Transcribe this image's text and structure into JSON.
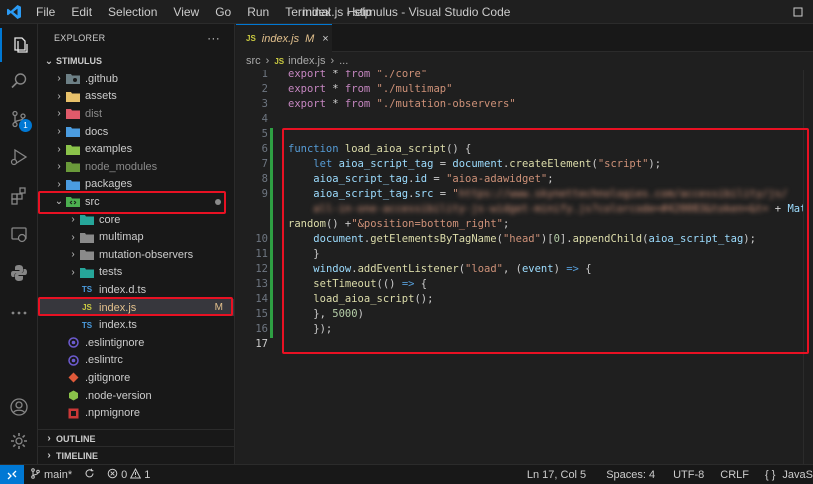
{
  "window": {
    "title": "index.js - stimulus - Visual Studio Code"
  },
  "menu": [
    "File",
    "Edit",
    "Selection",
    "View",
    "Go",
    "Run",
    "Terminal",
    "Help"
  ],
  "colors": {
    "accent": "#0078d4",
    "highlight_box": "#e81123",
    "modified": "#e2c08d",
    "added_line": "#2ea043"
  },
  "activity": {
    "source_control_badge": "1"
  },
  "sidebar": {
    "header": "EXPLORER",
    "more": "···",
    "root": "STIMULUS",
    "items": [
      {
        "label": ".github",
        "icon": "gear-folder-icon",
        "color": "#6d8086"
      },
      {
        "label": "assets",
        "icon": "folder-icon",
        "color": "#e8c16a"
      },
      {
        "label": "dist",
        "icon": "dist-folder-icon",
        "color": "#e05a6a",
        "dim": true
      },
      {
        "label": "docs",
        "icon": "docs-folder-icon",
        "color": "#4b9ce0"
      },
      {
        "label": "examples",
        "icon": "examples-folder-icon",
        "color": "#8bc34a"
      },
      {
        "label": "node_modules",
        "icon": "node-folder-icon",
        "color": "#8bc34a",
        "dim": true
      },
      {
        "label": "packages",
        "icon": "packages-folder-icon",
        "color": "#4b9ce0"
      },
      {
        "label": "src",
        "icon": "src-folder-icon",
        "color": "#4caf50"
      },
      {
        "label": "core",
        "icon": "core-folder-icon",
        "color": "#26a69a"
      },
      {
        "label": "multimap",
        "icon": "folder-icon",
        "color": "#8a8a8a"
      },
      {
        "label": "mutation-observers",
        "icon": "folder-icon",
        "color": "#8a8a8a"
      },
      {
        "label": "tests",
        "icon": "tests-folder-icon",
        "color": "#26a69a"
      },
      {
        "label": "index.d.ts",
        "icon": "ts-file-icon",
        "color": "#4b9ce0"
      },
      {
        "label": "index.js",
        "icon": "js-file-icon",
        "color": "#cbcb41",
        "status": "M"
      },
      {
        "label": "index.ts",
        "icon": "ts-file-icon",
        "color": "#4b9ce0"
      },
      {
        "label": ".eslintignore",
        "icon": "eslint-icon",
        "color": "#6d5bd0"
      },
      {
        "label": ".eslintrc",
        "icon": "eslint-icon",
        "color": "#6d5bd0"
      },
      {
        "label": ".gitignore",
        "icon": "git-icon",
        "color": "#e05a3a"
      },
      {
        "label": ".node-version",
        "icon": "node-icon",
        "color": "#8bc34a"
      },
      {
        "label": ".npmignore",
        "icon": "npm-icon",
        "color": "#cb3837"
      }
    ],
    "outline": "OUTLINE",
    "timeline": "TIMELINE"
  },
  "tab": {
    "label": "index.js",
    "status": "M",
    "close": "×"
  },
  "breadcrumb": {
    "folder": "src",
    "file": "index.js",
    "tail": "..."
  },
  "editor": {
    "line_numbers": [
      "1",
      "2",
      "3",
      "4",
      "5",
      "6",
      "7",
      "8",
      "9",
      "",
      "10",
      "11",
      "12",
      "13",
      "14",
      "15",
      "16",
      "17"
    ],
    "code": {
      "l1_mod": "./core",
      "l2_mod": "./multimap",
      "l3_mod": "./mutation-observers",
      "fn_name": "load_aioa_script",
      "var_name": "aioa_script_tag",
      "create_arg": "script",
      "id_value": "aioa-adawidget",
      "src_blurred_1": "https://www.skynettechnologies.com/accessibility/js/",
      "src_blurred_2": "all-in-one-accessibility-js-widget-minify.js?colorcode=#420083&token=&t=",
      "position_str": "&position=bottom_right",
      "tag_name": "head",
      "event_name": "load",
      "event_param": "event",
      "timeout": "5000"
    }
  },
  "status": {
    "branch": "main*",
    "errors": "0",
    "warnings": "1",
    "position": "Ln 17, Col 5",
    "spaces": "Spaces: 4",
    "encoding": "UTF-8",
    "eol": "CRLF",
    "language": "JavaS"
  }
}
